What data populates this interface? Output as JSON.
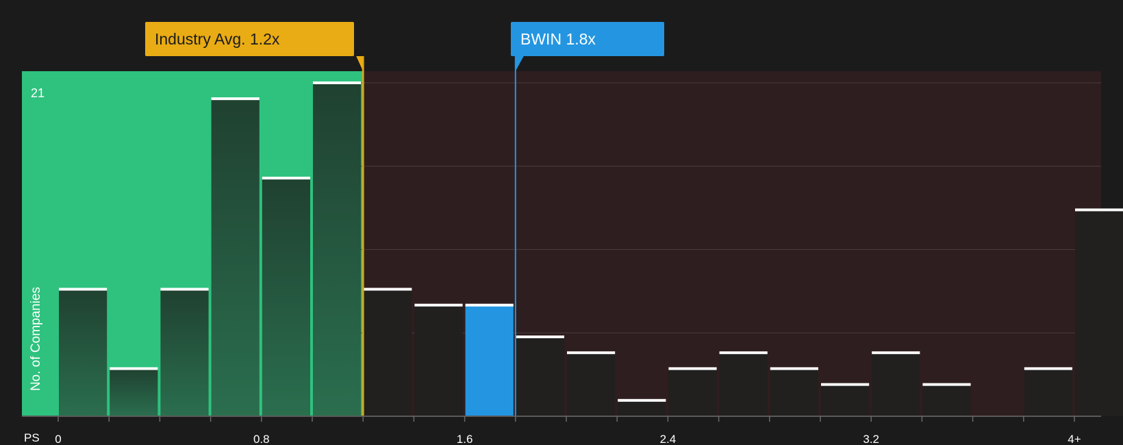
{
  "chart_data": {
    "type": "bar",
    "x_axis_prefix": "PS",
    "xlabel": "",
    "ylabel": "No. of Companies",
    "ylim": [
      0,
      21
    ],
    "y_max_label": "21",
    "bin_width": 0.2,
    "bins_start": [
      0.0,
      0.2,
      0.4,
      0.6,
      0.8,
      1.0,
      1.2,
      1.4,
      1.6,
      1.8,
      2.0,
      2.2,
      2.4,
      2.6,
      2.8,
      3.0,
      3.2,
      3.4,
      3.6,
      3.8,
      4.0
    ],
    "values": [
      8,
      3,
      8,
      20,
      15,
      21,
      8,
      7,
      7,
      5,
      4,
      1,
      3,
      4,
      3,
      2,
      4,
      2,
      0,
      3,
      13
    ],
    "x_ticks": [
      {
        "value": 0,
        "label": "0"
      },
      {
        "value": 0.8,
        "label": "0.8"
      },
      {
        "value": 1.6,
        "label": "1.6"
      },
      {
        "value": 2.4,
        "label": "2.4"
      },
      {
        "value": 3.2,
        "label": "3.2"
      },
      {
        "value": 4.0,
        "label": "4+"
      }
    ],
    "industry_avg": {
      "value": 1.2,
      "label": "Industry Avg. 1.2x"
    },
    "company": {
      "name": "BWIN",
      "value": 1.8,
      "label": "BWIN 1.8x",
      "highlight_bin_start": 1.6
    },
    "grid": true,
    "colors": {
      "background": "#1b1b1c",
      "undervalued_zone": "#2ec27e",
      "overvalued_zone": "#2f1e1f",
      "industry": "#e9ac14",
      "company": "#2496e1",
      "bar": "#221f1f",
      "bar_in_green": "#1f4a35",
      "cap": "#ffffff"
    }
  }
}
